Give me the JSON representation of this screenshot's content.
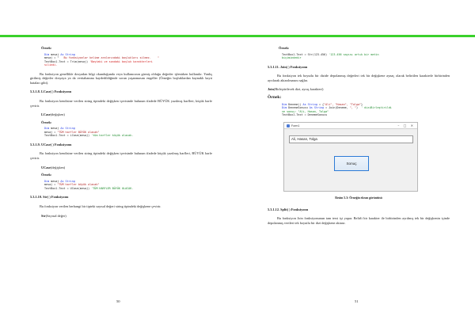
{
  "colors": {
    "accent_bar": "#3ad12b",
    "keyword": "#1e37e6",
    "string": "#b12121",
    "comment": "#1b8a2a",
    "error": "#d21d1d"
  },
  "left": {
    "ornek1": "Örnek:",
    "code1": {
      "l1_kw": "Dim",
      "l1_a": " mesaj ",
      "l1_kw2": "As String",
      "l2_a": "mesaj = \"",
      "l2_str": "   Bu fonksiyonlar kelime aralarındaki boşlukları silmez.    ",
      "l2_b": "\"",
      "l3_a": "TextBox1.Text = Trim(mesaj) ",
      "l3_cm": "'Baştaki ve sondaki boşluk karakterleri",
      "l4_cm": "silindi."
    },
    "p_gen": "Bu fonksiyon genellikle dosyadan bilgi okunduğunda veya kullanıcının girmiş olduğu değerler işlenirken kullanılır. Yanlış girilmiş değerler dosyaya ya da veritabanına kaydedildiğinde sorun yaşanmasını engeller (Örneğin boşluklardan kaynaklı kayıt hataları gibi).",
    "h_lcase": "5.3.1.8. LCase( ) Fonksiyonu",
    "p_lcase": "Bu fonksiyon kendisine verilen string tipindeki değişken içerisinde bulunan ifadede BÜYÜK yazılmış harfleri, küçük harfe çevirir.",
    "fn_lcase": "LCase",
    "fn_lcase_arg": "(değişken)",
    "ornek2": "Örnek:",
    "code2": {
      "l1_kw": "Dim",
      "l1_a": " mesaj ",
      "l1_kw2": "As String",
      "l2_a": "mesaj = ",
      "l2_str": "\"TÜM harfler BÜYÜK olacak\"",
      "l3_a": "TextBox1.Text = LCase(mesaj) ",
      "l3_cm": "'tüm harfler küçük olacak."
    },
    "h_ucase": "5.3.1.9. UCase( ) Fonksiyonu",
    "p_ucase": "Bu fonksiyon kendisine verilen string tipindeki değişken içerisinde bulunan ifadede küçük yazılmış harfleri, BÜYÜK harfe çevirir.",
    "fn_ucase": "UCase",
    "fn_ucase_arg": "(değişken)",
    "ornek3": "Örnek:",
    "code3": {
      "l1_kw": "Dim",
      "l1_a": " mesaj ",
      "l1_kw2": "As String",
      "l2_a": "mesaj = ",
      "l2_str": "\"TÜM harfler büyük olacak\"",
      "l3_a": "TextBox1.Text = UCase(mesaj) ",
      "l3_cm": "'TÜM HARFLER BÜYÜK OLACAK."
    },
    "h_str": "5.3.1.10. Str( ) Fonksiyonu",
    "p_str": "Bu fonksiyon verilen herhangi bir tipteki sayısal değeri string tipindeki değişkene çevirir.",
    "fn_str": "Str",
    "fn_str_arg": "(Sayısal değer)",
    "page_number": "50"
  },
  "right": {
    "ornek1": "Örnek:",
    "code1": {
      "l1_a": "TextBox1.Text = Str(123.456) ",
      "l1_cm": "'123.456 sayısı artık bir metin",
      "l2_cm": "biçimindedir"
    },
    "h_join": "5.3.1.11. Join( ) Fonksiyonu",
    "p_join": "Bu fonksiyon tek boyutlu bir dizide depolanmış değerleri tek bir değişkene aynaç olarak belirtilen karakterle birbirinden ayrılarak aktarılmasını sağlar.",
    "fn_join": "Join",
    "fn_join_arg": "(Birleştirilecek dizi, ayraç karakteri)",
    "ornek2": "Örnek:",
    "code2": {
      "l1_kw": "Dim",
      "l1_a": " Deneme() ",
      "l1_kw2": "As String",
      "l1_b": " = {",
      "l1_str": "\"Ali\", \"Hasan\", \"Tolga\"",
      "l1_c": "}",
      "l2_kw": "Dim",
      "l2_a": " DenemeSonucu ",
      "l2_kw2": "As String",
      "l2_b": " = Join(Deneme, ",
      "l2_str": "\", \"",
      "l2_c": ")  ",
      "l2_cm": "' diziBirleştirildi",
      "l3_cm": "ve sonuç: \"Ali, Hasan, Tolga\"",
      "l4_a": "TextBox1.Text = DenemeSonucu"
    },
    "figure": {
      "window_title": "Form1",
      "controls": "–  □  ✕",
      "input_value": "Ali, Hasan, Tolga",
      "button_label": "Sonuç"
    },
    "caption": "Resim 5.3: Örneğin ekran görüntüsü",
    "h_split": "5.3.1.12. Split( ) Fonksiyonu",
    "p_split": "Bu fonksiyon Join fonksiyonunun tam tersi işi yapar. Belirli bir karakter ile birbirinden ayrılmış tek bir değişkenin içinde depolanmış verileri tek boyutlu bir dizi değişkene aktarır.",
    "page_number": "51"
  }
}
